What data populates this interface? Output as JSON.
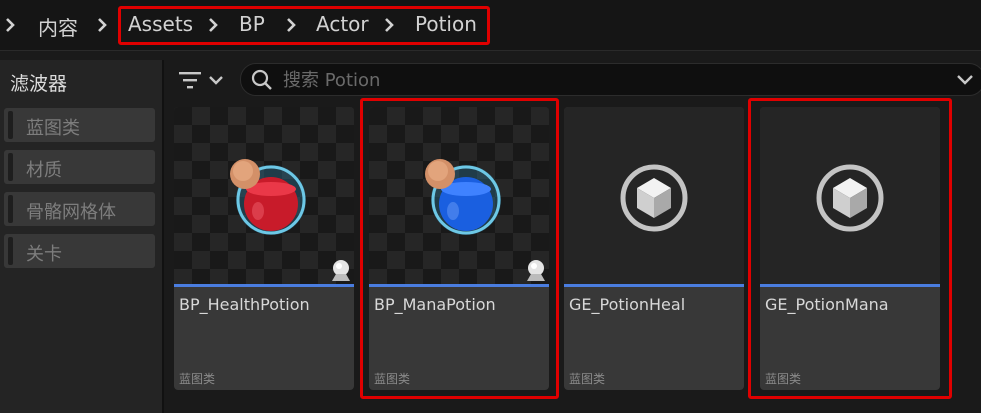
{
  "breadcrumb": {
    "items": [
      {
        "label": "内容"
      },
      {
        "label": "Assets"
      },
      {
        "label": "BP"
      },
      {
        "label": "Actor"
      },
      {
        "label": "Potion"
      }
    ]
  },
  "sidebar": {
    "title": "滤波器",
    "items": [
      {
        "label": "蓝图类"
      },
      {
        "label": "材质"
      },
      {
        "label": "骨骼网格体"
      },
      {
        "label": "关卡"
      }
    ]
  },
  "search": {
    "placeholder": "搜索 Potion",
    "value": ""
  },
  "assets": [
    {
      "name": "BP_HealthPotion",
      "type": "蓝图类",
      "thumbnail": "red-potion"
    },
    {
      "name": "BP_ManaPotion",
      "type": "蓝图类",
      "thumbnail": "blue-potion"
    },
    {
      "name": "GE_PotionHeal",
      "type": "蓝图类",
      "thumbnail": "cube-icon"
    },
    {
      "name": "GE_PotionMana",
      "type": "蓝图类",
      "thumbnail": "cube-icon"
    }
  ],
  "colors": {
    "highlight": "#e00000",
    "asset_bar": "#4a7de0",
    "health_potion": "#d0202a",
    "mana_potion": "#1a5fe0"
  }
}
